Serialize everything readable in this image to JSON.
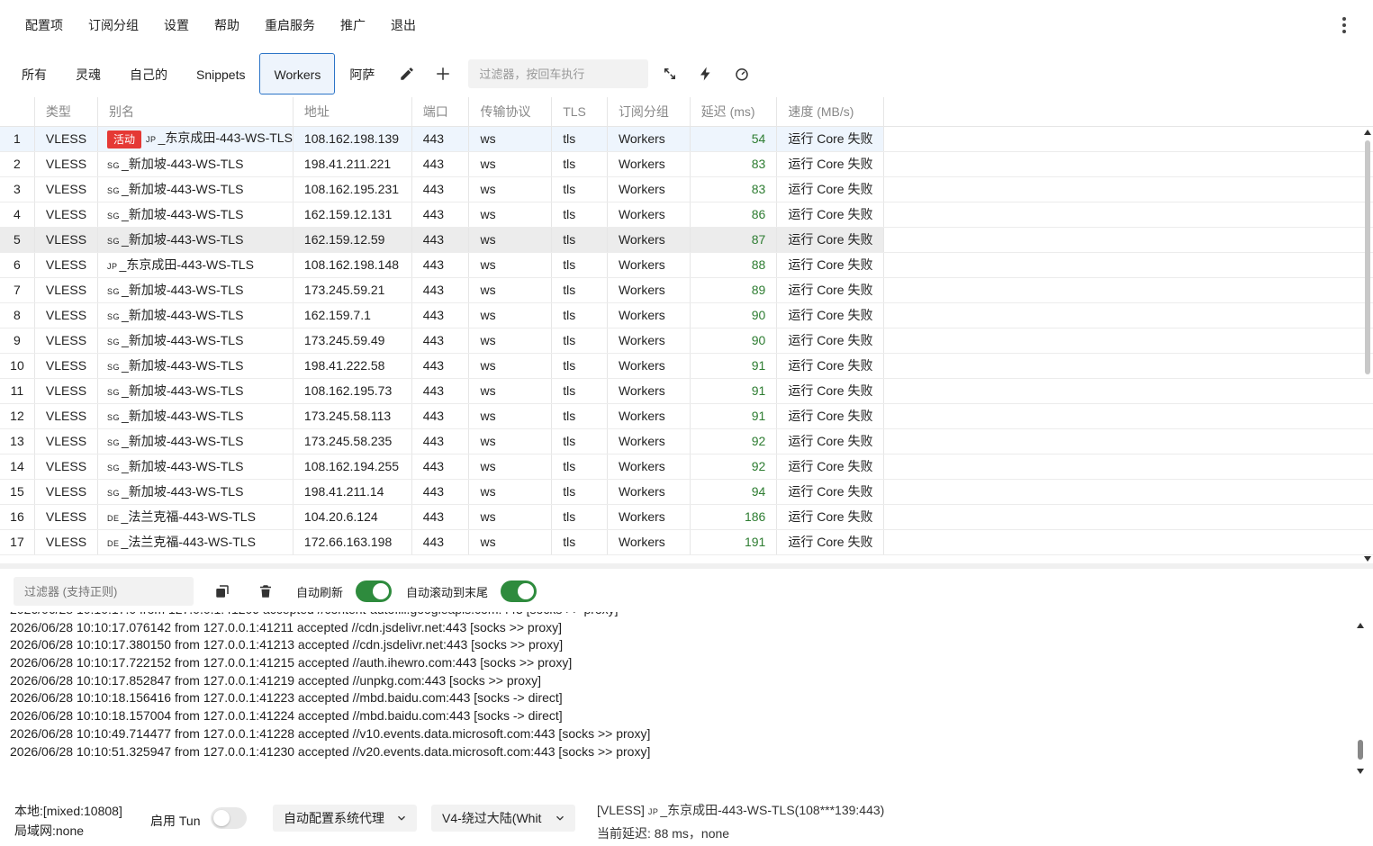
{
  "menubar": {
    "items": [
      "配置项",
      "订阅分组",
      "设置",
      "帮助",
      "重启服务",
      "推广",
      "退出"
    ]
  },
  "tabs": {
    "items": [
      "所有",
      "灵魂",
      "自己的",
      "Snippets",
      "Workers",
      "阿萨"
    ],
    "active": "Workers",
    "filter_placeholder": "过滤器，按回车执行"
  },
  "table": {
    "columns": [
      "",
      "类型",
      "别名",
      "地址",
      "端口",
      "传输协议",
      "TLS",
      "订阅分组",
      "延迟 (ms)",
      "速度 (MB/s)"
    ],
    "active_badge": "活动",
    "rows": [
      {
        "idx": "1",
        "type": "VLESS",
        "cc": "JP",
        "alias": "_东京成田-443-WS-TLS",
        "addr": "108.162.198.139",
        "port": "443",
        "net": "ws",
        "tls": "tls",
        "group": "Workers",
        "delay": "54",
        "speed": "运行 Core 失败"
      },
      {
        "idx": "2",
        "type": "VLESS",
        "cc": "SG",
        "alias": "_新加坡-443-WS-TLS",
        "addr": "198.41.211.221",
        "port": "443",
        "net": "ws",
        "tls": "tls",
        "group": "Workers",
        "delay": "83",
        "speed": "运行 Core 失败"
      },
      {
        "idx": "3",
        "type": "VLESS",
        "cc": "SG",
        "alias": "_新加坡-443-WS-TLS",
        "addr": "108.162.195.231",
        "port": "443",
        "net": "ws",
        "tls": "tls",
        "group": "Workers",
        "delay": "83",
        "speed": "运行 Core 失败"
      },
      {
        "idx": "4",
        "type": "VLESS",
        "cc": "SG",
        "alias": "_新加坡-443-WS-TLS",
        "addr": "162.159.12.131",
        "port": "443",
        "net": "ws",
        "tls": "tls",
        "group": "Workers",
        "delay": "86",
        "speed": "运行 Core 失败"
      },
      {
        "idx": "5",
        "type": "VLESS",
        "cc": "SG",
        "alias": "_新加坡-443-WS-TLS",
        "addr": "162.159.12.59",
        "port": "443",
        "net": "ws",
        "tls": "tls",
        "group": "Workers",
        "delay": "87",
        "speed": "运行 Core 失败"
      },
      {
        "idx": "6",
        "type": "VLESS",
        "cc": "JP",
        "alias": "_东京成田-443-WS-TLS",
        "addr": "108.162.198.148",
        "port": "443",
        "net": "ws",
        "tls": "tls",
        "group": "Workers",
        "delay": "88",
        "speed": "运行 Core 失败"
      },
      {
        "idx": "7",
        "type": "VLESS",
        "cc": "SG",
        "alias": "_新加坡-443-WS-TLS",
        "addr": "173.245.59.21",
        "port": "443",
        "net": "ws",
        "tls": "tls",
        "group": "Workers",
        "delay": "89",
        "speed": "运行 Core 失败"
      },
      {
        "idx": "8",
        "type": "VLESS",
        "cc": "SG",
        "alias": "_新加坡-443-WS-TLS",
        "addr": "162.159.7.1",
        "port": "443",
        "net": "ws",
        "tls": "tls",
        "group": "Workers",
        "delay": "90",
        "speed": "运行 Core 失败"
      },
      {
        "idx": "9",
        "type": "VLESS",
        "cc": "SG",
        "alias": "_新加坡-443-WS-TLS",
        "addr": "173.245.59.49",
        "port": "443",
        "net": "ws",
        "tls": "tls",
        "group": "Workers",
        "delay": "90",
        "speed": "运行 Core 失败"
      },
      {
        "idx": "10",
        "type": "VLESS",
        "cc": "SG",
        "alias": "_新加坡-443-WS-TLS",
        "addr": "198.41.222.58",
        "port": "443",
        "net": "ws",
        "tls": "tls",
        "group": "Workers",
        "delay": "91",
        "speed": "运行 Core 失败"
      },
      {
        "idx": "11",
        "type": "VLESS",
        "cc": "SG",
        "alias": "_新加坡-443-WS-TLS",
        "addr": "108.162.195.73",
        "port": "443",
        "net": "ws",
        "tls": "tls",
        "group": "Workers",
        "delay": "91",
        "speed": "运行 Core 失败"
      },
      {
        "idx": "12",
        "type": "VLESS",
        "cc": "SG",
        "alias": "_新加坡-443-WS-TLS",
        "addr": "173.245.58.113",
        "port": "443",
        "net": "ws",
        "tls": "tls",
        "group": "Workers",
        "delay": "91",
        "speed": "运行 Core 失败"
      },
      {
        "idx": "13",
        "type": "VLESS",
        "cc": "SG",
        "alias": "_新加坡-443-WS-TLS",
        "addr": "173.245.58.235",
        "port": "443",
        "net": "ws",
        "tls": "tls",
        "group": "Workers",
        "delay": "92",
        "speed": "运行 Core 失败"
      },
      {
        "idx": "14",
        "type": "VLESS",
        "cc": "SG",
        "alias": "_新加坡-443-WS-TLS",
        "addr": "108.162.194.255",
        "port": "443",
        "net": "ws",
        "tls": "tls",
        "group": "Workers",
        "delay": "92",
        "speed": "运行 Core 失败"
      },
      {
        "idx": "15",
        "type": "VLESS",
        "cc": "SG",
        "alias": "_新加坡-443-WS-TLS",
        "addr": "198.41.211.14",
        "port": "443",
        "net": "ws",
        "tls": "tls",
        "group": "Workers",
        "delay": "94",
        "speed": "运行 Core 失败"
      },
      {
        "idx": "16",
        "type": "VLESS",
        "cc": "DE",
        "alias": "_法兰克福-443-WS-TLS",
        "addr": "104.20.6.124",
        "port": "443",
        "net": "ws",
        "tls": "tls",
        "group": "Workers",
        "delay": "186",
        "speed": "运行 Core 失败"
      },
      {
        "idx": "17",
        "type": "VLESS",
        "cc": "DE",
        "alias": "_法兰克福-443-WS-TLS",
        "addr": "172.66.163.198",
        "port": "443",
        "net": "ws",
        "tls": "tls",
        "group": "Workers",
        "delay": "191",
        "speed": "运行 Core 失败"
      }
    ]
  },
  "logbar": {
    "filter_placeholder": "过滤器 (支持正则)",
    "auto_refresh_label": "自动刷新",
    "auto_scroll_label": "自动滚动到末尾"
  },
  "log": {
    "lines": [
      "2026/06/28 10:10:17.076142 from 127.0.0.1:41211 accepted //cdn.jsdelivr.net:443 [socks >> proxy]",
      "2026/06/28 10:10:17.380150 from 127.0.0.1:41213 accepted //cdn.jsdelivr.net:443 [socks >> proxy]",
      "2026/06/28 10:10:17.722152 from 127.0.0.1:41215 accepted //auth.ihewro.com:443 [socks >> proxy]",
      "2026/06/28 10:10:17.852847 from 127.0.0.1:41219 accepted //unpkg.com:443 [socks >> proxy]",
      "2026/06/28 10:10:18.156416 from 127.0.0.1:41223 accepted //mbd.baidu.com:443 [socks -> direct]",
      "2026/06/28 10:10:18.157004 from 127.0.0.1:41224 accepted //mbd.baidu.com:443 [socks -> direct]",
      "2026/06/28 10:10:49.714477 from 127.0.0.1:41228 accepted //v10.events.data.microsoft.com:443 [socks >> proxy]",
      "2026/06/28 10:10:51.325947 from 127.0.0.1:41230 accepted //v20.events.data.microsoft.com:443 [socks >> proxy]"
    ]
  },
  "statusbar": {
    "local": "本地:[mixed:10808]",
    "lan": "局域网:none",
    "tun_label": "启用 Tun",
    "proxy_mode": "自动配置系统代理",
    "routing": "V4-绕过大陆(Whit",
    "server_prefix": "[VLESS] ",
    "server_cc": "JP",
    "server_rest": "_东京成田-443-WS-TLS(108***139:443)",
    "latency": "当前延迟: 88 ms，none"
  },
  "colors": {
    "accent": "#2b74c7",
    "switch_on": "#2e8b3d",
    "delay_green": "#2e7d32",
    "active_badge": "#e53935"
  }
}
